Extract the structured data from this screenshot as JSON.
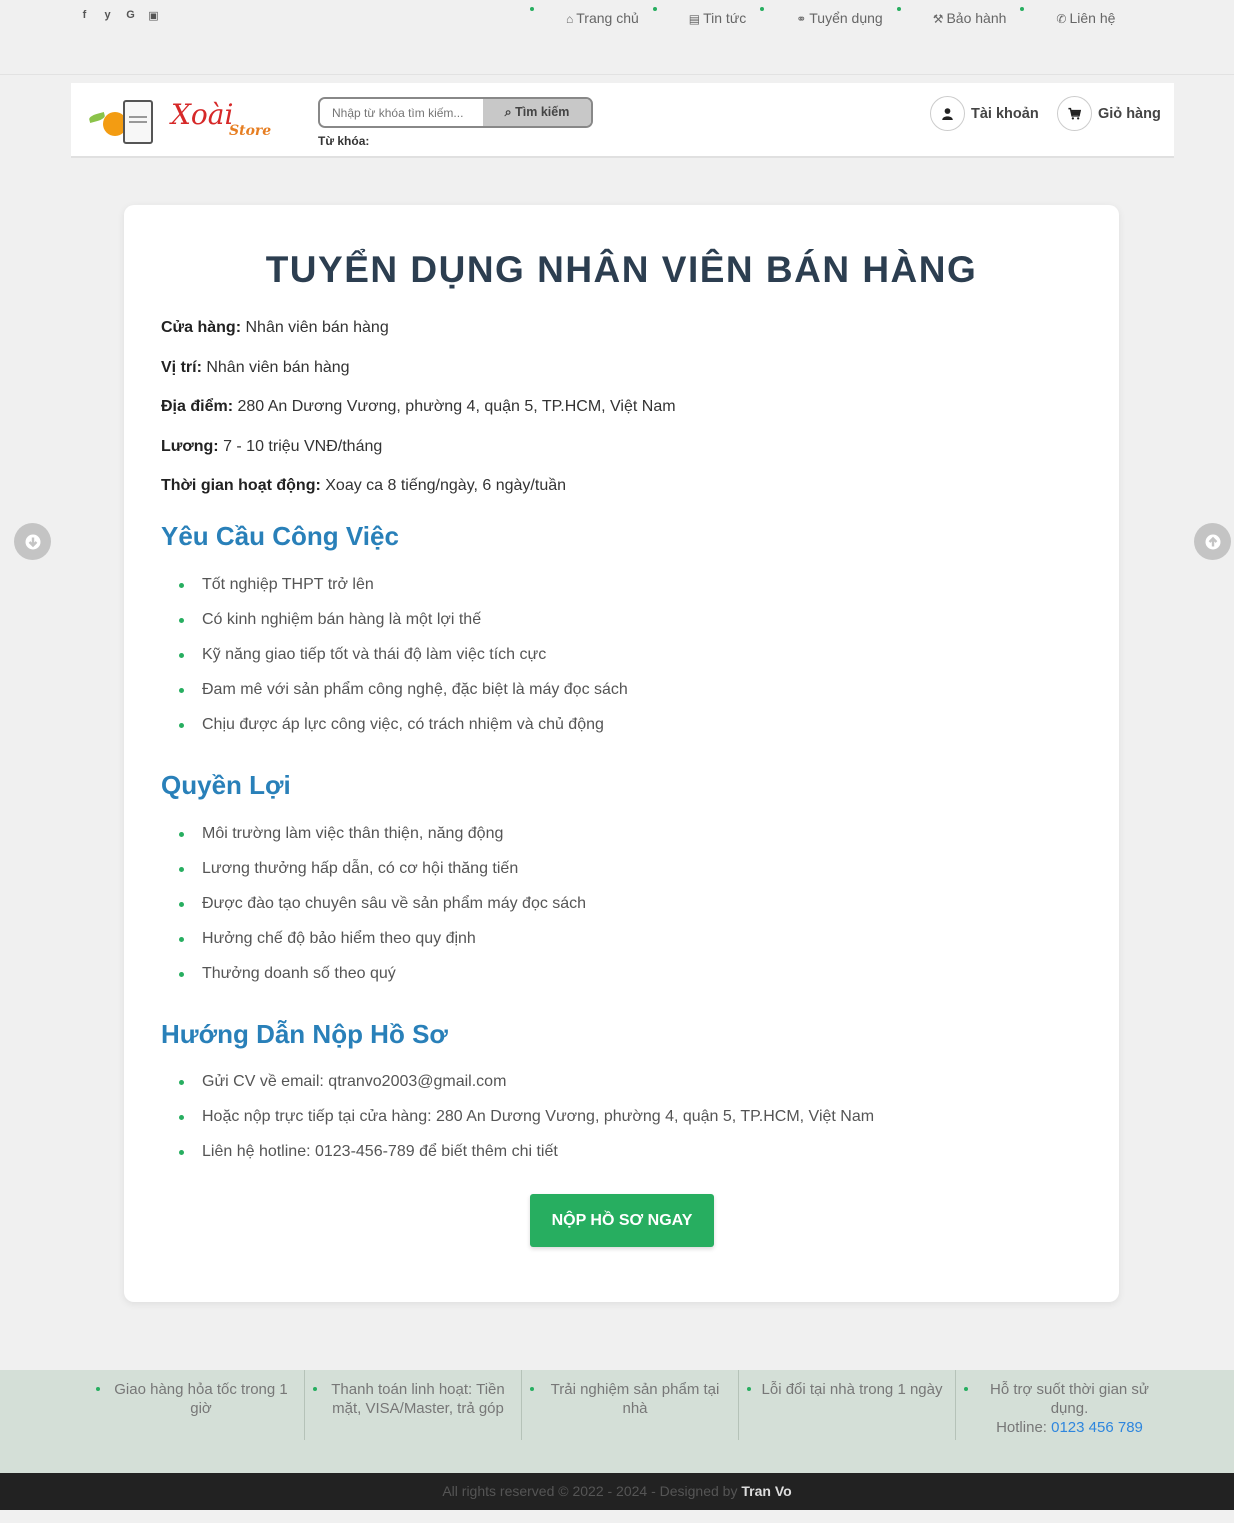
{
  "topbar": {
    "social": [
      {
        "icon": "facebook-icon",
        "glyph": "f"
      },
      {
        "icon": "twitter-icon",
        "glyph": "y"
      },
      {
        "icon": "google-icon",
        "glyph": "G"
      },
      {
        "icon": "youtube-icon",
        "glyph": "▣"
      }
    ],
    "nav": [
      {
        "icon": "home-icon",
        "label": "Trang chủ"
      },
      {
        "icon": "newspaper-icon",
        "label": "Tin tức"
      },
      {
        "icon": "handshake-icon",
        "label": "Tuyển dụng"
      },
      {
        "icon": "wrench-icon",
        "label": "Bảo hành"
      },
      {
        "icon": "phone-icon",
        "label": "Liên hệ"
      }
    ]
  },
  "header": {
    "logo_text": "Xoài",
    "logo_sub": "Store",
    "search_placeholder": "Nhập từ khóa tìm kiếm...",
    "search_button": "Tìm kiếm",
    "keyword_label": "Từ khóa:",
    "account_label": "Tài khoản",
    "cart_label": "Giỏ hàng"
  },
  "job": {
    "title": "TUYỂN DỤNG NHÂN VIÊN BÁN HÀNG",
    "info": [
      {
        "label": "Cửa hàng:",
        "value": "Nhân viên bán hàng"
      },
      {
        "label": "Vị trí:",
        "value": "Nhân viên bán hàng"
      },
      {
        "label": "Địa điểm:",
        "value": "280 An Dương Vương, phường 4, quận 5, TP.HCM, Việt Nam"
      },
      {
        "label": "Lương:",
        "value": "7 - 10 triệu VNĐ/tháng"
      },
      {
        "label": "Thời gian hoạt động:",
        "value": "Xoay ca 8 tiếng/ngày, 6 ngày/tuần"
      }
    ],
    "requirements_title": "Yêu Cầu Công Việc",
    "requirements": [
      "Tốt nghiệp THPT trở lên",
      "Có kinh nghiệm bán hàng là một lợi thế",
      "Kỹ năng giao tiếp tốt và thái độ làm việc tích cực",
      "Đam mê với sản phẩm công nghệ, đặc biệt là máy đọc sách",
      "Chịu được áp lực công việc, có trách nhiệm và chủ động"
    ],
    "benefits_title": "Quyền Lợi",
    "benefits": [
      "Môi trường làm việc thân thiện, năng động",
      "Lương thưởng hấp dẫn, có cơ hội thăng tiến",
      "Được đào tạo chuyên sâu về sản phẩm máy đọc sách",
      "Hưởng chế độ bảo hiểm theo quy định",
      "Thưởng doanh số theo quý"
    ],
    "guide_title": "Hướng Dẫn Nộp Hồ Sơ",
    "guide": [
      "Gửi CV về email: qtranvo2003@gmail.com",
      "Hoặc nộp trực tiếp tại cửa hàng: 280 An Dương Vương, phường 4, quận 5, TP.HCM, Việt Nam",
      "Liên hệ hotline: 0123-456-789 để biết thêm chi tiết"
    ],
    "apply_button": "NỘP HỒ SƠ NGAY"
  },
  "features": [
    "Giao hàng hỏa tốc trong 1 giờ",
    "Thanh toán linh hoạt: Tiền mặt, VISA/Master, trả góp",
    "Trải nghiệm sản phẩm tại nhà",
    "Lỗi đổi tại nhà trong 1 ngày",
    "Hỗ trợ suốt thời gian sử dụng."
  ],
  "hotline_label": "Hotline:",
  "hotline_number": "0123 456 789",
  "footer": {
    "copyright": "All rights reserved © 2022 - 2024 - Designed by",
    "author": "Tran Vo"
  },
  "colors": {
    "accent_green": "#27ae60",
    "heading_blue": "#2980b9",
    "title_dark": "#2c3e50"
  }
}
